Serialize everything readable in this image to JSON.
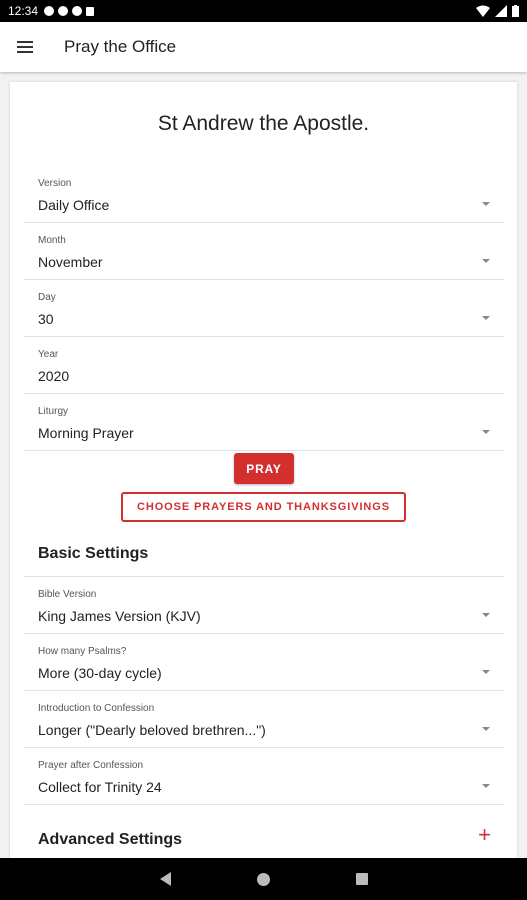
{
  "status_bar": {
    "time": "12:34"
  },
  "app_bar": {
    "title": "Pray the Office",
    "menu_icon": "hamburger-icon"
  },
  "feast": "St Andrew the Apostle.",
  "form": {
    "version": {
      "label": "Version",
      "value": "Daily Office"
    },
    "month": {
      "label": "Month",
      "value": "November"
    },
    "day": {
      "label": "Day",
      "value": "30"
    },
    "year": {
      "label": "Year",
      "value": "2020"
    },
    "liturgy": {
      "label": "Liturgy",
      "value": "Morning Prayer"
    }
  },
  "buttons": {
    "pray": "PRAY",
    "choose": "CHOOSE PRAYERS AND THANKSGIVINGS"
  },
  "basic_settings": {
    "title": "Basic Settings",
    "bible_version": {
      "label": "Bible Version",
      "value": "King James Version (KJV)"
    },
    "psalms": {
      "label": "How many Psalms?",
      "value": "More (30-day cycle)"
    },
    "intro_confession": {
      "label": "Introduction to Confession",
      "value": "Longer (\"Dearly beloved brethren...\")"
    },
    "prayer_after_confession": {
      "label": "Prayer after Confession",
      "value": "Collect for Trinity 24"
    }
  },
  "advanced_settings": {
    "title": "Advanced Settings",
    "expand_symbol": "+"
  },
  "colors": {
    "accent": "#d32f2f"
  }
}
